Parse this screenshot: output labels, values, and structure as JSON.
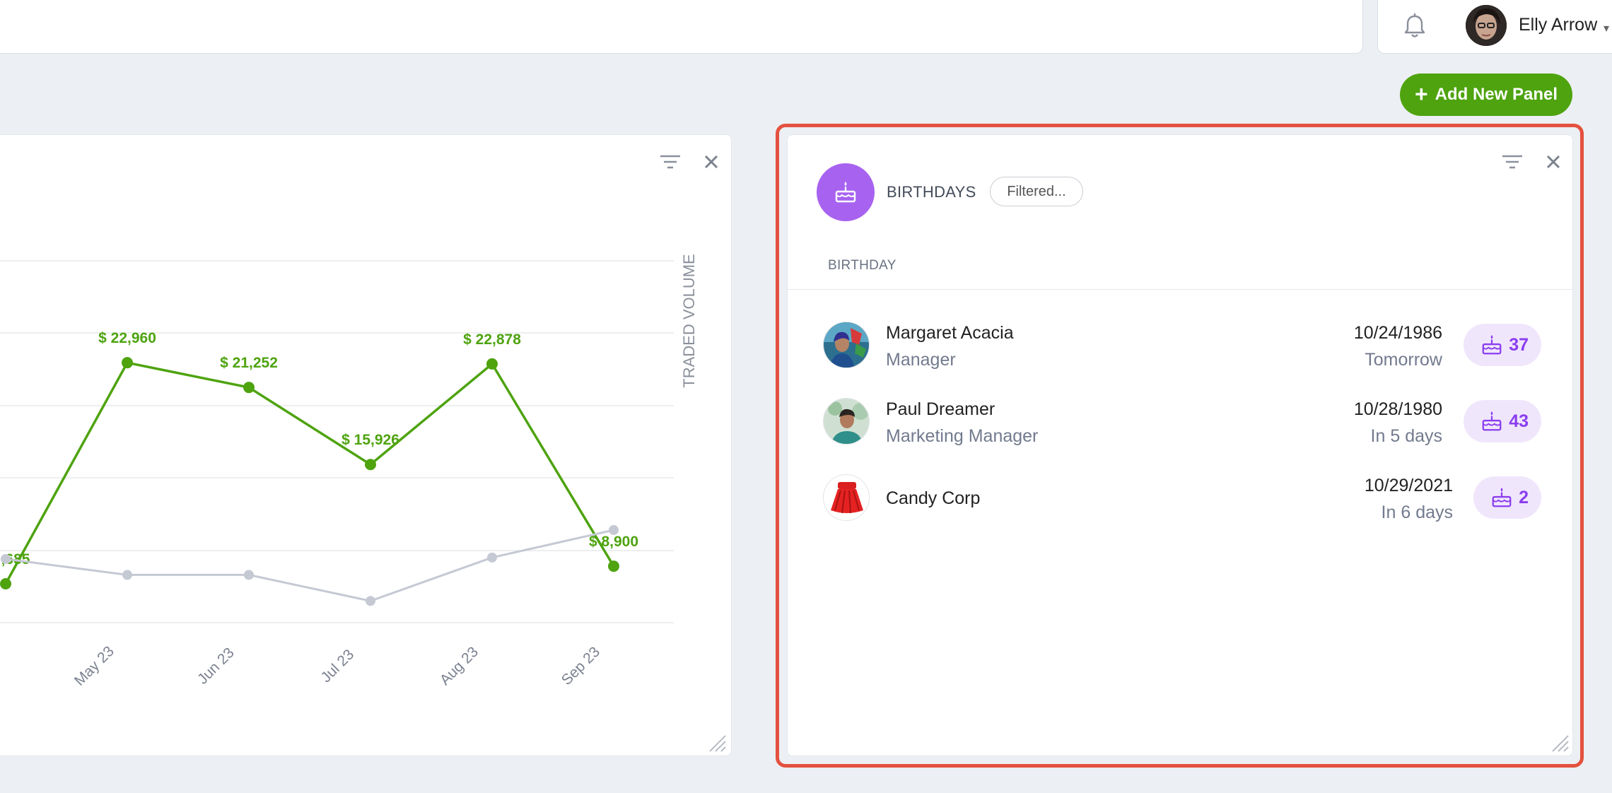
{
  "header": {
    "user_name": "Elly Arrow",
    "icons": [
      "bell-icon",
      "avatar",
      "chevron-down-icon"
    ]
  },
  "toolbar": {
    "add_panel_label": "Add New Panel"
  },
  "chart_panel": {
    "chart_data": {
      "type": "line",
      "categories": [
        "",
        "May 23",
        "Jun 23",
        "Jul 23",
        "Aug 23",
        "Sep 23"
      ],
      "series": [
        {
          "values": [
            7685,
            22960,
            21252,
            15926,
            22878,
            8900
          ],
          "labels": [
            ",685",
            "$ 22,960",
            "$ 21,252",
            "$ 15,926",
            "$ 22,878",
            "$ 8,900"
          ],
          "color": "#4ea30f"
        },
        {
          "values": [
            9400,
            8300,
            8300,
            6500,
            9500,
            11400
          ],
          "color": "#c5c9d3"
        }
      ],
      "secondary_ylabel": "TRADED VOLUME",
      "ylim": [
        5000,
        30000
      ],
      "grid": true
    }
  },
  "birthdays": {
    "title": "BIRTHDAYS",
    "filter_chip": "Filtered...",
    "column_header": "BIRTHDAY",
    "accent": "#a862f0",
    "rows": [
      {
        "name": "Margaret Acacia",
        "role": "Manager",
        "date": "10/24/1986",
        "when": "Tomorrow",
        "age": "37"
      },
      {
        "name": "Paul Dreamer",
        "role": "Marketing Manager",
        "date": "10/28/1980",
        "when": "In 5 days",
        "age": "43"
      },
      {
        "name": "Candy Corp",
        "role": "",
        "date": "10/29/2021",
        "when": "In 6 days",
        "age": "2"
      }
    ]
  }
}
